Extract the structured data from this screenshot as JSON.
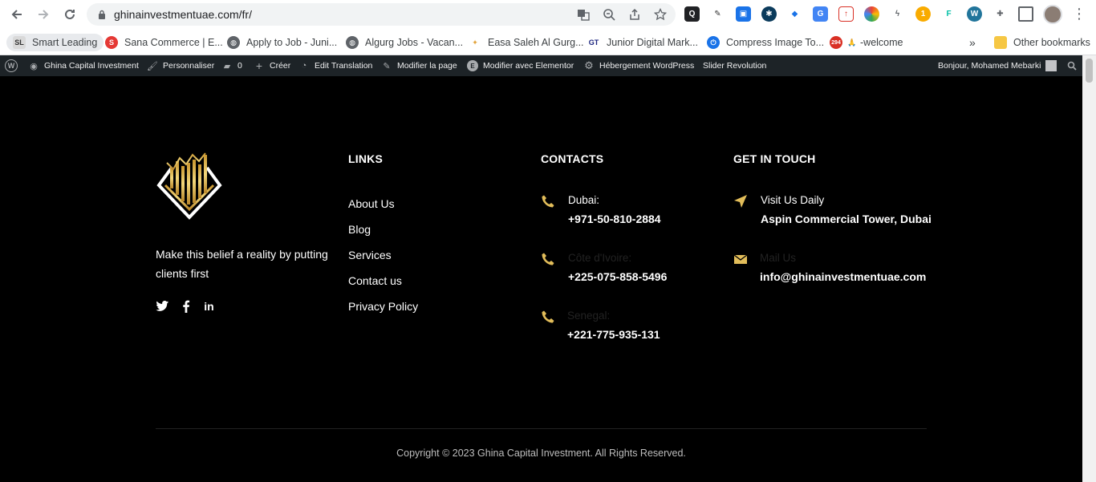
{
  "browser": {
    "url": "ghinainvestmentuae.com/fr/",
    "bookmarks": [
      {
        "label": "Smart Leading",
        "icon": "smart-leading-icon"
      },
      {
        "label": "Sana Commerce | E...",
        "icon": "sana-icon"
      },
      {
        "label": "Apply to Job - Juni...",
        "icon": "globe-icon"
      },
      {
        "label": "Algurg Jobs - Vacan...",
        "icon": "globe-icon"
      },
      {
        "label": "Easa Saleh Al Gurg...",
        "icon": "star-icon"
      },
      {
        "label": "Junior Digital Mark...",
        "icon": "gt-icon"
      },
      {
        "label": "Compress Image To...",
        "icon": "compress-icon"
      },
      {
        "label": "-welcome",
        "icon": "welcome-icon"
      }
    ],
    "bookmark_badge": "294",
    "other_bookmarks": "Other bookmarks",
    "chevron": "»"
  },
  "wpbar": {
    "site_name": "Ghina Capital Investment",
    "customize": "Personnaliser",
    "comments_count": "0",
    "create": "Créer",
    "edit_translation": "Edit Translation",
    "edit_page": "Modifier la page",
    "edit_elementor": "Modifier avec Elementor",
    "hosting": "Hébergement WordPress",
    "slider": "Slider Revolution",
    "greeting": "Bonjour, Mohamed Mebarki"
  },
  "footer": {
    "tagline": "Make this belief a reality by putting clients first",
    "links_title": "LINKS",
    "links": [
      "About Us",
      "Blog",
      "Services",
      "Contact us",
      "Privacy Policy"
    ],
    "contacts_title": "CONTACTS",
    "contacts": [
      {
        "label": "Dubai:",
        "value": "+971-50-810-2884",
        "label_color": "#ffffff"
      },
      {
        "label": "Côte d'Ivoire:",
        "value": "+225-075-858-5496",
        "label_color": "#222222"
      },
      {
        "label": "Senegal:",
        "value": "+221-775-935-131",
        "label_color": "#222222"
      }
    ],
    "touch_title": "GET IN TOUCH",
    "touch": [
      {
        "label": "Visit Us Daily",
        "value": "Aspin Commercial Tower, Dubai",
        "label_color": "#ffffff"
      },
      {
        "label": "Mail Us",
        "value": "info@ghinainvestmentuae.com",
        "label_color": "#222222"
      }
    ],
    "copyright": "Copyright © 2023 Ghina Capital Investment. All Rights Reserved."
  },
  "colors": {
    "gold": "#e2bd5a",
    "background": "#000000",
    "wpbar": "#1d2327"
  }
}
